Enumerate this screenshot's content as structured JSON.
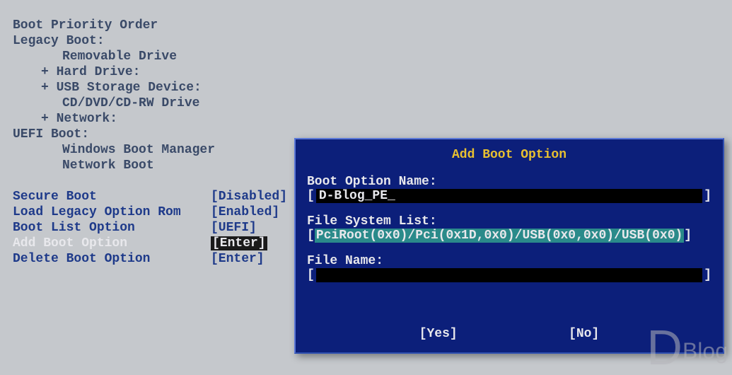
{
  "header": "Boot Priority Order",
  "legacy": {
    "title": "Legacy Boot:",
    "items": [
      "Removable Drive",
      "Hard Drive:",
      "USB Storage Device:",
      "CD/DVD/CD-RW Drive",
      "Network:"
    ]
  },
  "uefi": {
    "title": "UEFI Boot:",
    "items": [
      "Windows Boot Manager",
      "Network Boot"
    ]
  },
  "settings": [
    {
      "label": "Secure Boot",
      "value": "[Disabled]",
      "selected": false
    },
    {
      "label": "Load Legacy Option Rom",
      "value": "[Enabled]",
      "selected": false
    },
    {
      "label": "Boot List Option",
      "value": "[UEFI]",
      "selected": false
    },
    {
      "label": "Add Boot Option",
      "value": "[Enter]",
      "selected": true
    },
    {
      "label": "Delete Boot Option",
      "value": "[Enter]",
      "selected": false
    }
  ],
  "dialog": {
    "title": "Add Boot Option",
    "field_name_label": "Boot Option Name:",
    "field_name_value": "D-Blog_PE",
    "fsl_label": "File System List:",
    "fsl_value": "PciRoot(0x0)/Pci(0x1D,0x0)/USB(0x0,0x0)/USB(0x0)",
    "file_label": "File Name:",
    "file_value": "",
    "yes": "[Yes]",
    "no": "[No]"
  },
  "bracket_open": "[",
  "bracket_close": "]",
  "plus": "+ ",
  "watermark": {
    "d": "D",
    "text": "Blog"
  }
}
